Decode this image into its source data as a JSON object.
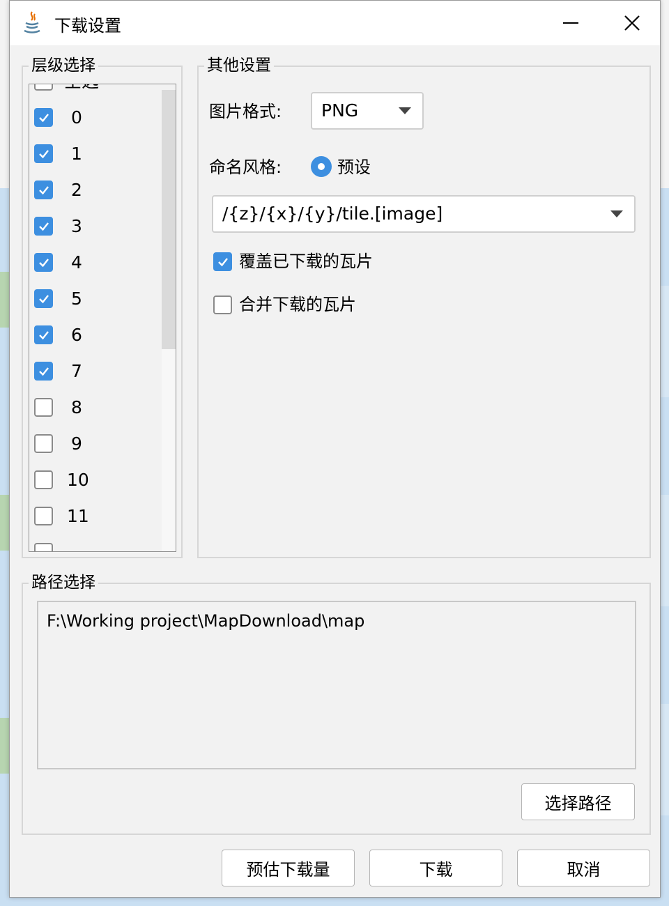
{
  "window": {
    "title": "下载设置",
    "minimize_icon": "minimize-icon",
    "close_icon": "close-icon"
  },
  "levels": {
    "label": "层级选择",
    "select_all": {
      "label": "全选",
      "checked": false
    },
    "items": [
      {
        "label": "0",
        "checked": true
      },
      {
        "label": "1",
        "checked": true
      },
      {
        "label": "2",
        "checked": true
      },
      {
        "label": "3",
        "checked": true
      },
      {
        "label": "4",
        "checked": true
      },
      {
        "label": "5",
        "checked": true
      },
      {
        "label": "6",
        "checked": true
      },
      {
        "label": "7",
        "checked": true
      },
      {
        "label": "8",
        "checked": false
      },
      {
        "label": "9",
        "checked": false
      },
      {
        "label": "10",
        "checked": false
      },
      {
        "label": "11",
        "checked": false
      }
    ]
  },
  "other": {
    "label": "其他设置",
    "image_format_label": "图片格式:",
    "image_format_value": "PNG",
    "naming_label": "命名风格:",
    "naming_radio_label": "预设",
    "naming_pattern": "/{z}/{x}/{y}/tile.[image]",
    "overwrite_label": "覆盖已下载的瓦片",
    "overwrite_checked": true,
    "merge_label": "合并下载的瓦片",
    "merge_checked": false
  },
  "path": {
    "label": "路径选择",
    "value": "F:\\Working project\\MapDownload\\map",
    "choose_button": "选择路径"
  },
  "buttons": {
    "estimate": "预估下载量",
    "download": "下载",
    "cancel": "取消"
  },
  "colors": {
    "accent": "#3d8fe0",
    "dialog_bg": "#f2f2f2"
  }
}
